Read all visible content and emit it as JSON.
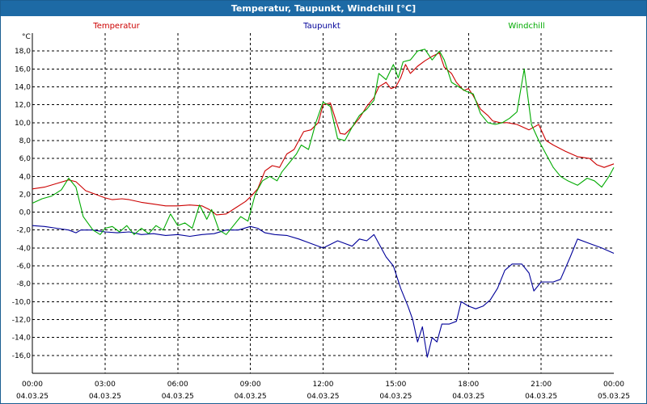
{
  "window": {
    "title": "Temperatur, Taupunkt, Windchill [°C]"
  },
  "chart_data": {
    "type": "line",
    "title": "Temperatur, Taupunkt, Windchill [°C]",
    "ylabel": "°C",
    "xlabel": "",
    "ylim": [
      -18,
      20
    ],
    "xlim": [
      0,
      24
    ],
    "yticks": [
      18,
      16,
      14,
      12,
      10,
      8,
      6,
      4,
      2,
      0,
      -2,
      -4,
      -6,
      -8,
      -10,
      -12,
      -14,
      -16
    ],
    "ytick_labels": [
      "18,0",
      "16,0",
      "14,0",
      "12,0",
      "10,0",
      "8,0",
      "6,0",
      "4,0",
      "2,0",
      "0,0",
      "-2,0",
      "-4,0",
      "-6,0",
      "-8,0",
      "-10,0",
      "-12,0",
      "-14,0",
      "-16,0"
    ],
    "xticks": [
      {
        "hour": 0,
        "time": "00:00",
        "date": "04.03.25"
      },
      {
        "hour": 3,
        "time": "03:00",
        "date": "04.03.25"
      },
      {
        "hour": 6,
        "time": "06:00",
        "date": "04.03.25"
      },
      {
        "hour": 9,
        "time": "09:00",
        "date": "04.03.25"
      },
      {
        "hour": 12,
        "time": "12:00",
        "date": "04.03.25"
      },
      {
        "hour": 15,
        "time": "15:00",
        "date": "04.03.25"
      },
      {
        "hour": 18,
        "time": "18:00",
        "date": "04.03.25"
      },
      {
        "hour": 21,
        "time": "21:00",
        "date": "04.03.25"
      },
      {
        "hour": 24,
        "time": "00:00",
        "date": "05.03.25"
      }
    ],
    "grid": true,
    "legend_position": "top",
    "series": [
      {
        "name": "Temperatur",
        "color": "#cc0000",
        "points": [
          [
            0,
            2.6
          ],
          [
            0.5,
            2.8
          ],
          [
            1,
            3.2
          ],
          [
            1.5,
            3.6
          ],
          [
            1.8,
            3.4
          ],
          [
            2.2,
            2.4
          ],
          [
            2.6,
            2.0
          ],
          [
            3,
            1.6
          ],
          [
            3.3,
            1.4
          ],
          [
            3.7,
            1.5
          ],
          [
            4,
            1.4
          ],
          [
            4.5,
            1.1
          ],
          [
            5,
            0.9
          ],
          [
            5.5,
            0.7
          ],
          [
            6,
            0.7
          ],
          [
            6.5,
            0.8
          ],
          [
            7,
            0.7
          ],
          [
            7.3,
            0.3
          ],
          [
            7.6,
            -0.3
          ],
          [
            8,
            -0.2
          ],
          [
            8.4,
            0.5
          ],
          [
            8.8,
            1.2
          ],
          [
            9,
            1.7
          ],
          [
            9.3,
            2.6
          ],
          [
            9.6,
            4.6
          ],
          [
            9.9,
            5.2
          ],
          [
            10.2,
            5.0
          ],
          [
            10.5,
            6.5
          ],
          [
            10.8,
            7.0
          ],
          [
            11,
            8.0
          ],
          [
            11.2,
            9.0
          ],
          [
            11.5,
            9.2
          ],
          [
            11.8,
            10.0
          ],
          [
            12,
            12.0
          ],
          [
            12.3,
            12.2
          ],
          [
            12.5,
            10.5
          ],
          [
            12.7,
            8.8
          ],
          [
            12.9,
            8.7
          ],
          [
            13.2,
            9.5
          ],
          [
            13.5,
            10.5
          ],
          [
            13.8,
            11.8
          ],
          [
            14.1,
            12.8
          ],
          [
            14.3,
            14.0
          ],
          [
            14.6,
            14.5
          ],
          [
            14.8,
            13.8
          ],
          [
            15,
            14.0
          ],
          [
            15.2,
            15.0
          ],
          [
            15.4,
            16.5
          ],
          [
            15.6,
            15.5
          ],
          [
            15.9,
            16.3
          ],
          [
            16.2,
            16.9
          ],
          [
            16.5,
            17.4
          ],
          [
            16.8,
            17.8
          ],
          [
            17,
            16.2
          ],
          [
            17.3,
            15.5
          ],
          [
            17.5,
            14.5
          ],
          [
            17.8,
            13.6
          ],
          [
            18,
            13.8
          ],
          [
            18.2,
            13.0
          ],
          [
            18.5,
            11.5
          ],
          [
            18.8,
            10.8
          ],
          [
            19,
            10.2
          ],
          [
            19.3,
            10.0
          ],
          [
            19.6,
            10.0
          ],
          [
            20,
            9.8
          ],
          [
            20.5,
            9.2
          ],
          [
            20.9,
            9.8
          ],
          [
            21.2,
            8.0
          ],
          [
            21.5,
            7.5
          ],
          [
            22,
            6.8
          ],
          [
            22.5,
            6.2
          ],
          [
            23,
            6.0
          ],
          [
            23.3,
            5.3
          ],
          [
            23.6,
            5.0
          ],
          [
            24,
            5.4
          ]
        ]
      },
      {
        "name": "Taupunkt",
        "color": "#000099",
        "points": [
          [
            0,
            -1.5
          ],
          [
            0.5,
            -1.6
          ],
          [
            1,
            -1.8
          ],
          [
            1.5,
            -2.0
          ],
          [
            1.8,
            -2.3
          ],
          [
            2,
            -2.0
          ],
          [
            2.5,
            -2.0
          ],
          [
            3,
            -2.2
          ],
          [
            3.5,
            -2.3
          ],
          [
            4,
            -2.2
          ],
          [
            4.5,
            -2.5
          ],
          [
            5,
            -2.4
          ],
          [
            5.5,
            -2.6
          ],
          [
            6,
            -2.5
          ],
          [
            6.5,
            -2.7
          ],
          [
            7,
            -2.5
          ],
          [
            7.5,
            -2.4
          ],
          [
            8,
            -2.0
          ],
          [
            8.5,
            -2.0
          ],
          [
            9,
            -1.6
          ],
          [
            9.3,
            -1.8
          ],
          [
            9.6,
            -2.3
          ],
          [
            10,
            -2.5
          ],
          [
            10.5,
            -2.6
          ],
          [
            11,
            -3.0
          ],
          [
            11.5,
            -3.5
          ],
          [
            12,
            -4.0
          ],
          [
            12.3,
            -3.6
          ],
          [
            12.6,
            -3.2
          ],
          [
            12.9,
            -3.5
          ],
          [
            13.2,
            -3.8
          ],
          [
            13.5,
            -3.0
          ],
          [
            13.8,
            -3.2
          ],
          [
            14.1,
            -2.5
          ],
          [
            14.3,
            -3.5
          ],
          [
            14.6,
            -5.0
          ],
          [
            14.9,
            -6.0
          ],
          [
            15.2,
            -8.5
          ],
          [
            15.5,
            -10.5
          ],
          [
            15.7,
            -12.0
          ],
          [
            15.9,
            -14.5
          ],
          [
            16.1,
            -12.8
          ],
          [
            16.3,
            -16.2
          ],
          [
            16.5,
            -14.0
          ],
          [
            16.7,
            -14.5
          ],
          [
            16.9,
            -12.5
          ],
          [
            17.2,
            -12.5
          ],
          [
            17.5,
            -12.2
          ],
          [
            17.7,
            -10.0
          ],
          [
            18,
            -10.5
          ],
          [
            18.3,
            -10.8
          ],
          [
            18.6,
            -10.5
          ],
          [
            18.9,
            -9.8
          ],
          [
            19.2,
            -8.5
          ],
          [
            19.5,
            -6.5
          ],
          [
            19.8,
            -5.8
          ],
          [
            20.2,
            -5.8
          ],
          [
            20.5,
            -6.8
          ],
          [
            20.7,
            -8.8
          ],
          [
            21,
            -7.8
          ],
          [
            21.5,
            -7.8
          ],
          [
            21.8,
            -7.5
          ],
          [
            22.2,
            -5.0
          ],
          [
            22.5,
            -3.0
          ],
          [
            23,
            -3.5
          ],
          [
            23.5,
            -4.0
          ],
          [
            24,
            -4.6
          ]
        ]
      },
      {
        "name": "Windchill",
        "color": "#00aa00",
        "points": [
          [
            0,
            1.0
          ],
          [
            0.4,
            1.5
          ],
          [
            0.8,
            1.8
          ],
          [
            1.2,
            2.5
          ],
          [
            1.5,
            3.8
          ],
          [
            1.8,
            2.8
          ],
          [
            2.1,
            -0.5
          ],
          [
            2.5,
            -2.0
          ],
          [
            2.8,
            -2.5
          ],
          [
            3,
            -1.8
          ],
          [
            3.3,
            -1.6
          ],
          [
            3.6,
            -2.2
          ],
          [
            3.9,
            -1.5
          ],
          [
            4.2,
            -2.5
          ],
          [
            4.5,
            -1.8
          ],
          [
            4.8,
            -2.4
          ],
          [
            5.1,
            -1.5
          ],
          [
            5.4,
            -2.0
          ],
          [
            5.7,
            -0.2
          ],
          [
            6,
            -1.5
          ],
          [
            6.3,
            -1.2
          ],
          [
            6.6,
            -1.8
          ],
          [
            6.9,
            0.8
          ],
          [
            7.2,
            -0.8
          ],
          [
            7.4,
            0.3
          ],
          [
            7.7,
            -2.0
          ],
          [
            8,
            -2.5
          ],
          [
            8.3,
            -1.5
          ],
          [
            8.6,
            -0.5
          ],
          [
            8.9,
            -1.0
          ],
          [
            9.2,
            2.0
          ],
          [
            9.5,
            3.5
          ],
          [
            9.8,
            4.0
          ],
          [
            10.1,
            3.5
          ],
          [
            10.3,
            4.5
          ],
          [
            10.6,
            5.5
          ],
          [
            10.9,
            6.5
          ],
          [
            11.1,
            7.5
          ],
          [
            11.4,
            7.0
          ],
          [
            11.7,
            10.0
          ],
          [
            12,
            12.3
          ],
          [
            12.3,
            11.8
          ],
          [
            12.6,
            8.2
          ],
          [
            12.9,
            8.0
          ],
          [
            13.2,
            9.5
          ],
          [
            13.5,
            10.8
          ],
          [
            13.8,
            11.5
          ],
          [
            14.1,
            12.5
          ],
          [
            14.3,
            15.5
          ],
          [
            14.6,
            14.8
          ],
          [
            14.9,
            16.5
          ],
          [
            15.1,
            15.0
          ],
          [
            15.3,
            16.8
          ],
          [
            15.6,
            17.0
          ],
          [
            15.9,
            18.0
          ],
          [
            16.2,
            18.2
          ],
          [
            16.5,
            17.0
          ],
          [
            16.8,
            18.0
          ],
          [
            17,
            17.0
          ],
          [
            17.3,
            14.5
          ],
          [
            17.6,
            14.0
          ],
          [
            17.9,
            13.5
          ],
          [
            18.2,
            13.2
          ],
          [
            18.5,
            11.0
          ],
          [
            18.8,
            10.0
          ],
          [
            19.1,
            9.8
          ],
          [
            19.4,
            10.0
          ],
          [
            19.7,
            10.5
          ],
          [
            20,
            11.2
          ],
          [
            20.3,
            16.0
          ],
          [
            20.6,
            9.8
          ],
          [
            20.9,
            8.0
          ],
          [
            21.2,
            6.5
          ],
          [
            21.5,
            5.0
          ],
          [
            21.8,
            4.0
          ],
          [
            22.1,
            3.5
          ],
          [
            22.5,
            3.0
          ],
          [
            22.9,
            3.8
          ],
          [
            23.2,
            3.5
          ],
          [
            23.5,
            2.8
          ],
          [
            23.8,
            4.0
          ],
          [
            24,
            5.0
          ]
        ]
      }
    ]
  }
}
